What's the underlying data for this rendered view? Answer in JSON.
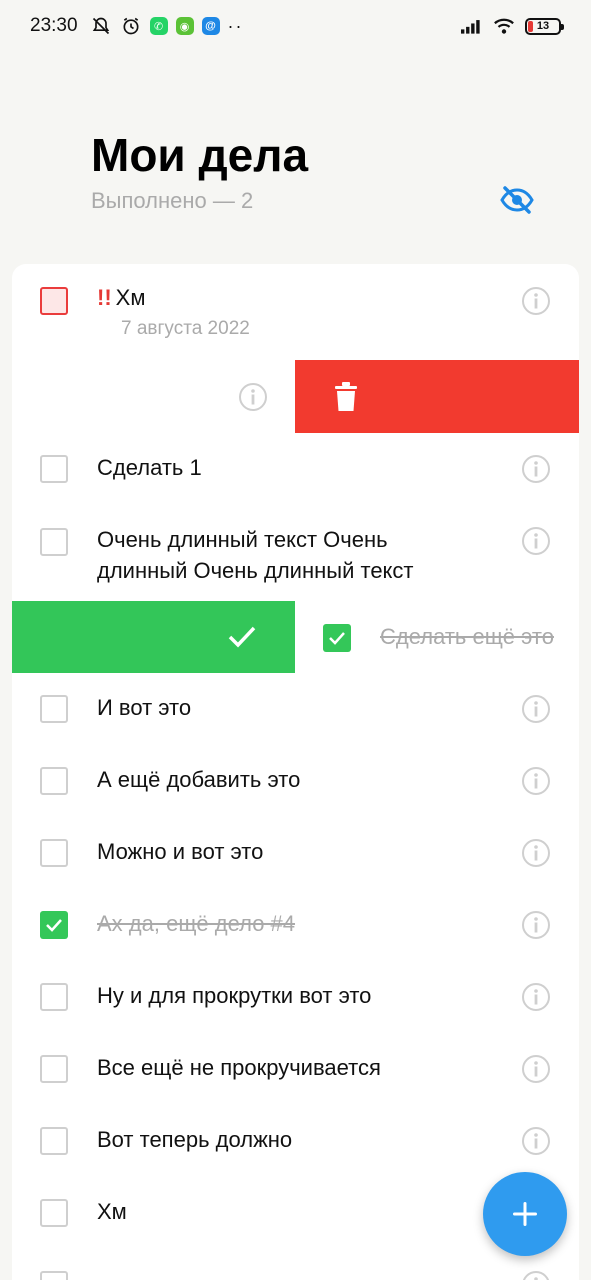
{
  "status_bar": {
    "time": "23:30",
    "battery": "13",
    "icons": [
      "bell-off-icon",
      "alarm-icon",
      "whatsapp-icon",
      "android-icon",
      "mail-icon",
      "more-icon",
      "signal-icon",
      "wifi-icon",
      "battery-icon"
    ]
  },
  "header": {
    "title": "Мои дела",
    "subtitle": "Выполнено — 2",
    "visibility_icon": "eye-off-icon"
  },
  "colors": {
    "accent": "#2f9bef",
    "danger": "#f23a2f",
    "success": "#33c659",
    "important": "#ea3c3c",
    "background": "#f6f6f3"
  },
  "tasks": [
    {
      "text": "Хм",
      "priority": "!!",
      "date": "7 августа 2022",
      "done": false,
      "important": true
    },
    {
      "text": "",
      "swipe": "delete"
    },
    {
      "text": "Сделать 1",
      "done": false
    },
    {
      "text": "Очень длинный текст Очень длинный Очень длинный текст",
      "done": false
    },
    {
      "text": "Сделать ещё это",
      "done": true,
      "swipe": "complete"
    },
    {
      "text": "И вот это",
      "done": false
    },
    {
      "text": "А ещё добавить это",
      "done": false
    },
    {
      "text": "Можно и вот это",
      "done": false
    },
    {
      "text": "Ах да, ещё дело #4",
      "done": true
    },
    {
      "text": "Ну и для прокрутки вот это",
      "done": false
    },
    {
      "text": "Все ещё не прокручивается",
      "done": false
    },
    {
      "text": "Вот теперь должно",
      "done": false
    },
    {
      "text": "Хм",
      "done": false
    }
  ],
  "fab": {
    "icon": "plus-icon"
  }
}
